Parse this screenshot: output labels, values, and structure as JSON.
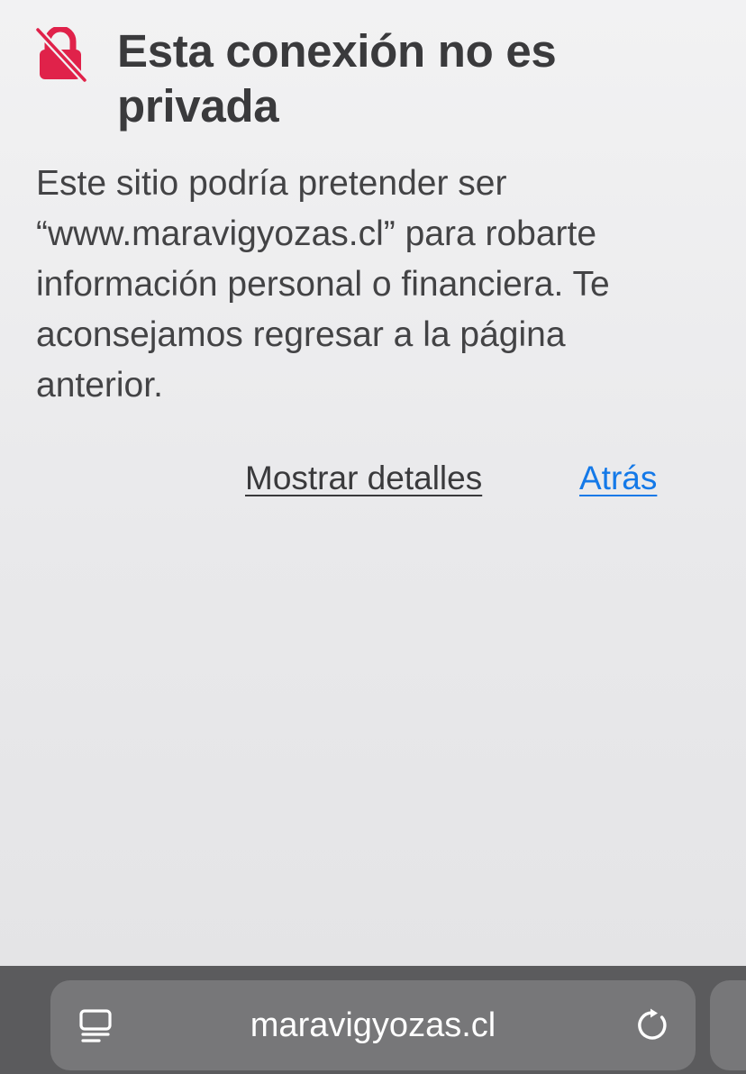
{
  "warning": {
    "title": "Esta conexión no es privada",
    "message": "Este sitio podría pretender ser “www.maravigyozas.cl” para robarte información personal o financiera. Te aconsejamos regresar a la página anterior.",
    "details_label": "Mostrar detalles",
    "back_label": "Atrás",
    "icon": "lock-slash-icon"
  },
  "toolbar": {
    "url": "maravigyozas.cl",
    "reader_icon": "page-menu-icon",
    "reload_icon": "reload-icon"
  },
  "colors": {
    "alert_red": "#e0224a",
    "link_blue": "#1479e8",
    "toolbar_bg": "#5b5b5d",
    "address_bar_bg": "#777779",
    "text_dark": "#3a3a3c"
  }
}
